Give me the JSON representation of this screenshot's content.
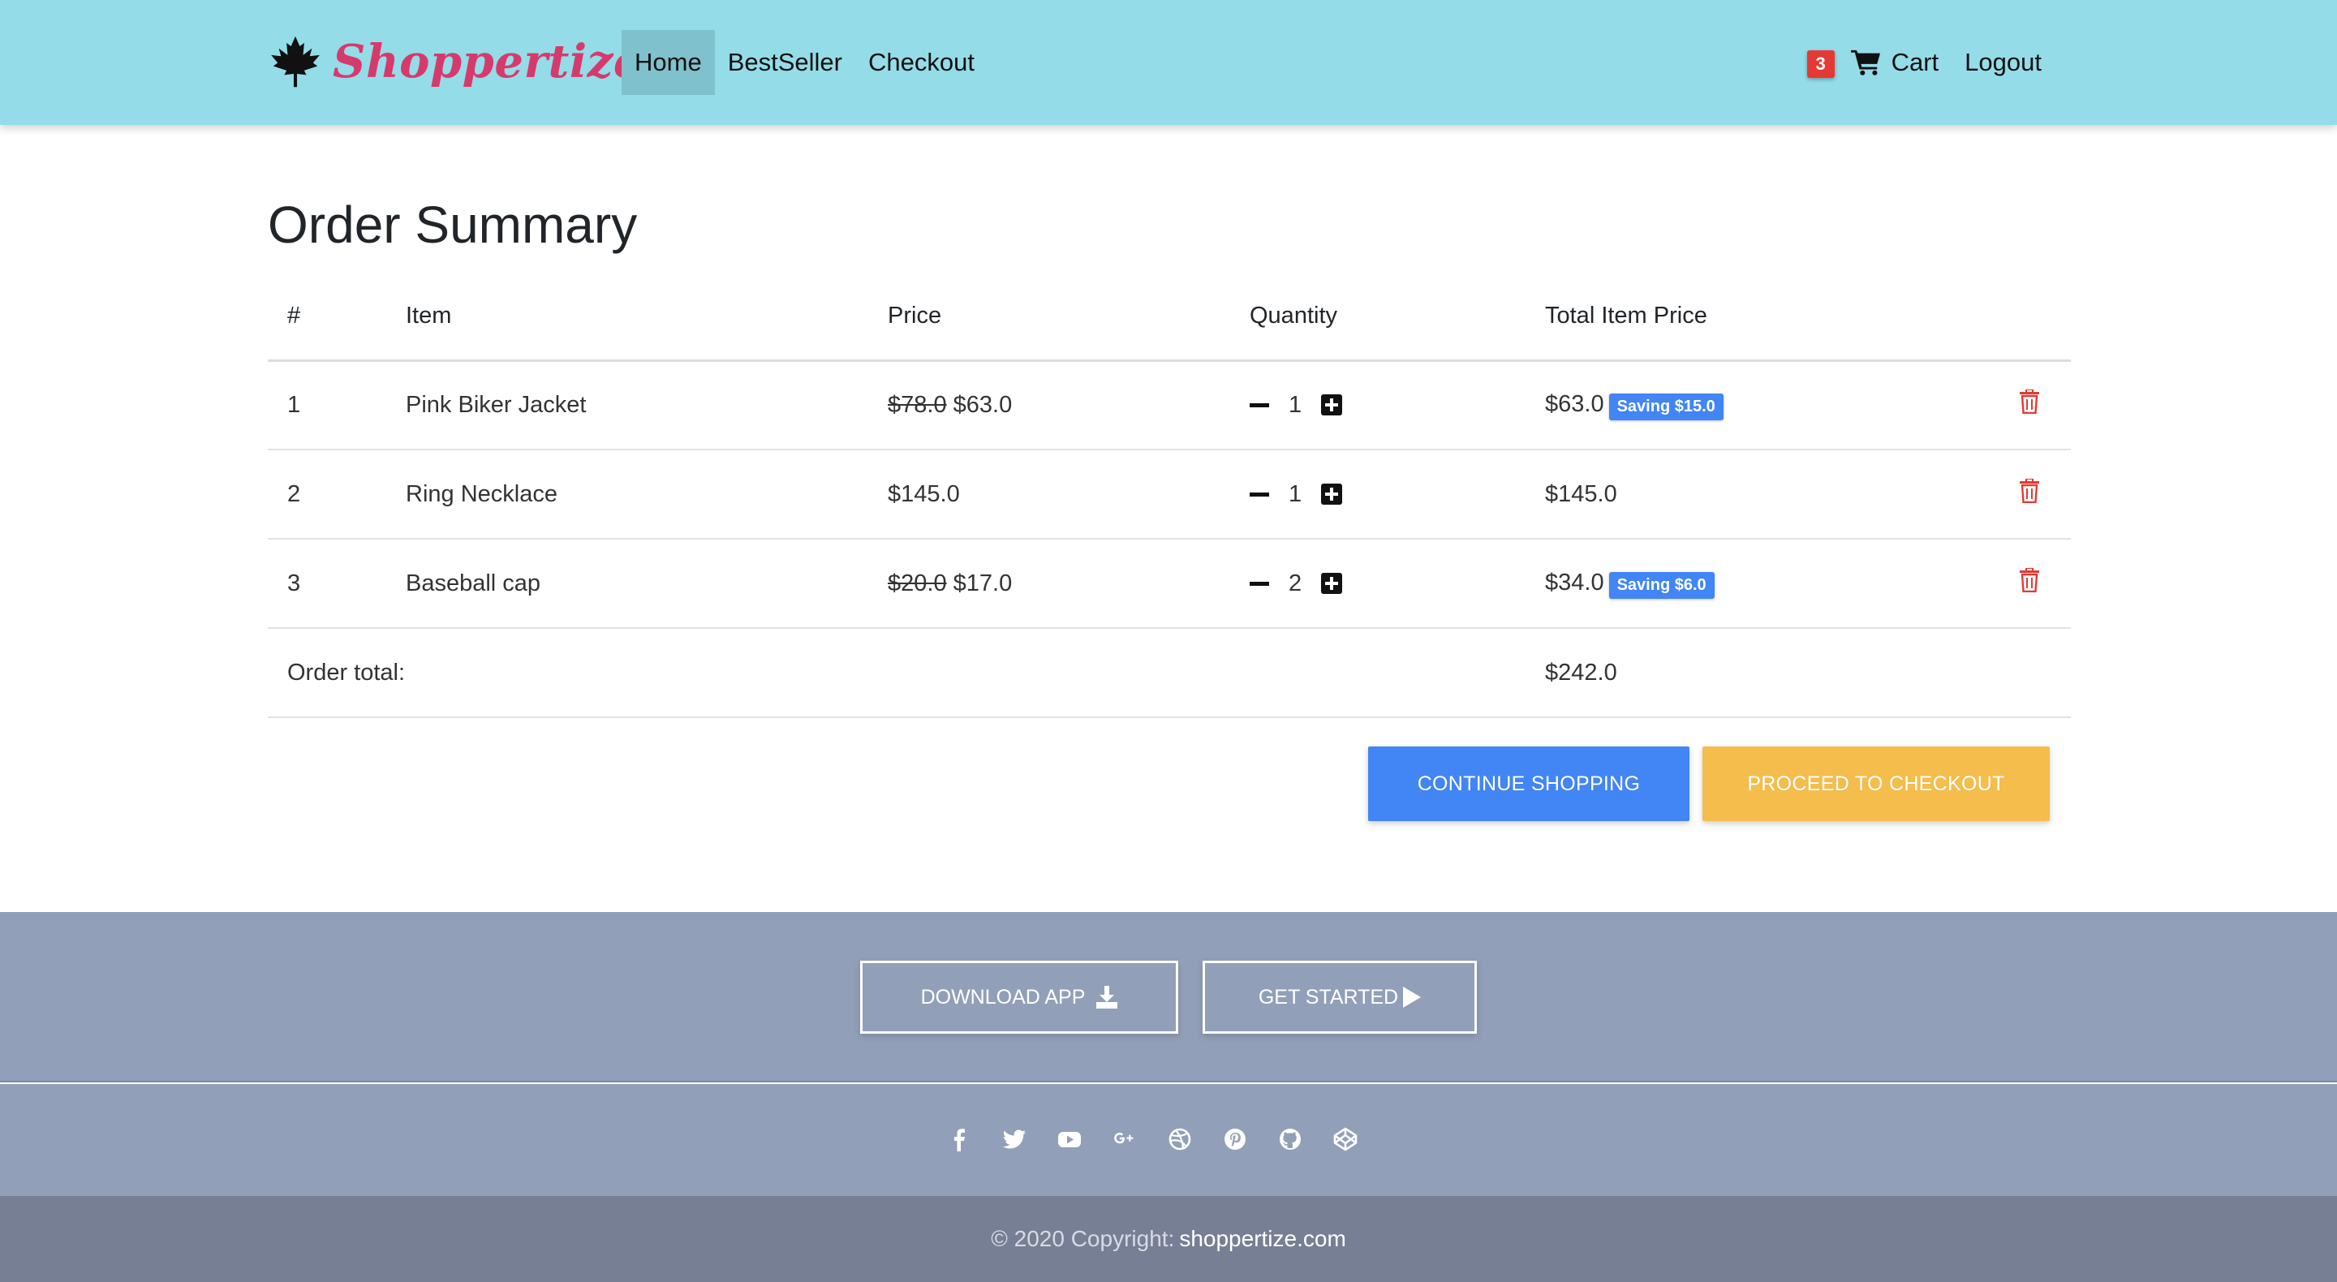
{
  "navbar": {
    "brand": "Shoppertize",
    "links": [
      "Home",
      "BestSeller",
      "Checkout"
    ],
    "active_link": "Home",
    "cart_count": "3",
    "cart_label": "Cart",
    "logout_label": "Logout"
  },
  "main": {
    "title": "Order Summary",
    "columns": [
      "#",
      "Item",
      "Price",
      "Quantity",
      "Total Item Price"
    ],
    "rows": [
      {
        "num": "1",
        "item": "Pink Biker Jacket",
        "old_price": "$78.0",
        "price": "$63.0",
        "qty": "1",
        "total": "$63.0",
        "saving": "Saving $15.0"
      },
      {
        "num": "2",
        "item": "Ring Necklace",
        "old_price": "",
        "price": "$145.0",
        "qty": "1",
        "total": "$145.0",
        "saving": ""
      },
      {
        "num": "3",
        "item": "Baseball cap",
        "old_price": "$20.0",
        "price": "$17.0",
        "qty": "2",
        "total": "$34.0",
        "saving": "Saving $6.0"
      }
    ],
    "order_total_label": "Order total:",
    "order_total": "$242.0",
    "continue_label": "Continue shopping",
    "checkout_label": "Proceed to checkout"
  },
  "footer": {
    "download_label": "Download app",
    "started_label": "Get started",
    "social_icons": [
      "facebook-icon",
      "twitter-icon",
      "youtube-icon",
      "google-plus-icon",
      "dribbble-icon",
      "pinterest-icon",
      "github-icon",
      "codepen-icon"
    ],
    "copyright": "© 2020 Copyright:",
    "site": "shoppertize.com"
  },
  "colors": {
    "navbar_bg": "#94dce8",
    "brand": "#d63a6b",
    "primary": "#4285f4",
    "warning": "#f4bd4c",
    "danger": "#e53935",
    "footer_bg": "#929fb8",
    "footer_bottom_bg": "#777f94"
  }
}
